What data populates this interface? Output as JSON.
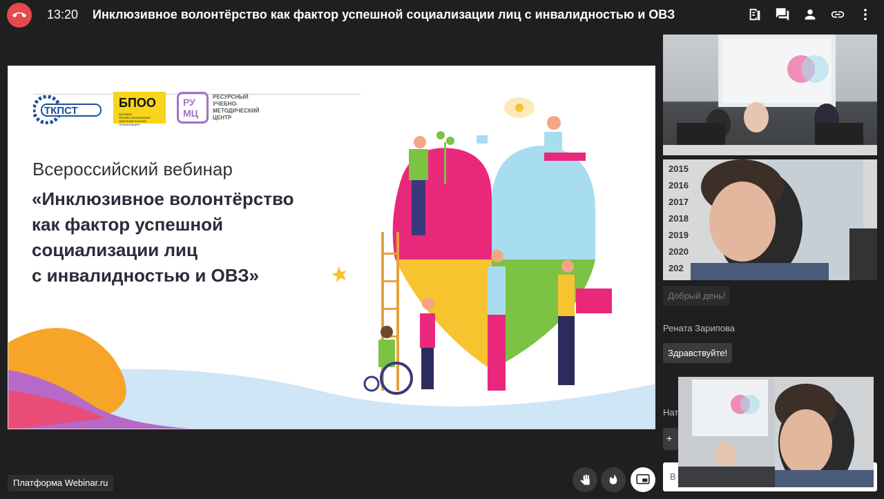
{
  "header": {
    "time": "13:20",
    "title": "Инклюзивное волонтёрство как фактор успешной социализации лиц с инвалидностью и ОВЗ",
    "icons": [
      "notes-icon",
      "chat-icon",
      "participants-icon",
      "link-icon",
      "more-icon"
    ]
  },
  "slide": {
    "logo_tkpst": "ТКПСТ",
    "logo_bpoo": "БПОО",
    "logo_bpoo_sub": "БАЗОВАЯ ПРОФЕССИОНАЛЬНАЯ ОБРАЗОВАТЕЛЬНАЯ ОРГАНИЗАЦИЯ",
    "logo_rumc": "РУ МЦ",
    "rumc_caption": "РЕСУРСНЫЙ УЧЕБНО-МЕТОДИЧЕСКИЙ ЦЕНТР",
    "subtitle": "Всероссийский вебинар",
    "main_line1": "«Инклюзивное волонтёрство",
    "main_line2": "как фактор успешной",
    "main_line3": "социализации лиц",
    "main_line4": "с инвалидностью и ОВЗ»"
  },
  "videos": {
    "v2_years": [
      "2015",
      "2016",
      "2017",
      "2018",
      "2019",
      "2020",
      "202"
    ]
  },
  "chat": {
    "msg1": "Добрый день!",
    "name2": "Рената Зарипова",
    "msg2": "Здравствуйте!",
    "partial_name": "Нат",
    "plus": "+",
    "input_partial": "В"
  },
  "footer": {
    "platform": "Платформа Webinar.ru"
  },
  "colors": {
    "accent_red": "#e5484d",
    "bg": "#1f1f1f",
    "logo_yellow": "#f7d51a",
    "logo_purple": "#a072c6"
  }
}
